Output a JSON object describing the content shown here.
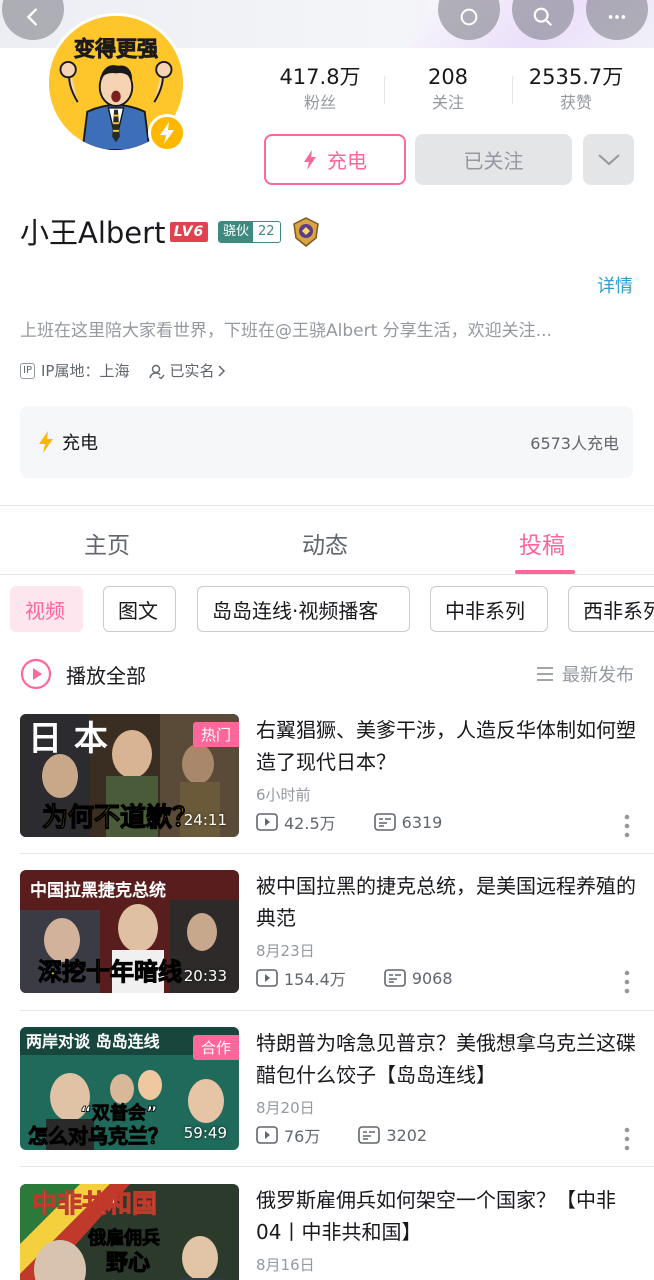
{
  "header": {
    "icons": [
      "back-icon",
      "share-icon",
      "search-icon",
      "more-icon"
    ]
  },
  "avatar_text": "变得更强",
  "stats": [
    {
      "value": "417.8万",
      "label": "粉丝"
    },
    {
      "value": "208",
      "label": "关注"
    },
    {
      "value": "2535.7万",
      "label": "获赞"
    }
  ],
  "actions": {
    "charge_label": "充电",
    "followed_label": "已关注"
  },
  "profile": {
    "name": "小王Albert",
    "level": "LV6",
    "medal_name": "骁伙",
    "medal_level": "22",
    "detail_link": "详情",
    "bio": "上班在这里陪大家看世界，下班在@王骁Albert 分享生活，欢迎关注...",
    "ip_tag": "IP",
    "ip_location": "IP属地：上海",
    "verified": "已实名"
  },
  "charge_card": {
    "label": "充电",
    "count": "6573人充电"
  },
  "tabs": [
    {
      "label": "主页",
      "active": false
    },
    {
      "label": "动态",
      "active": false
    },
    {
      "label": "投稿",
      "active": true
    }
  ],
  "chips": [
    {
      "label": "视频",
      "active": true
    },
    {
      "label": "图文",
      "active": false
    },
    {
      "label": "岛岛连线·视频播客",
      "active": false
    },
    {
      "label": "中非系列",
      "active": false
    },
    {
      "label": "西非系列",
      "active": false
    }
  ],
  "play_all": {
    "label": "播放全部",
    "sort": "最新发布"
  },
  "videos": [
    {
      "title": "右翼猖獗、美爹干涉，人造反华体制如何塑造了现代日本？",
      "date": "6小时前",
      "views": "42.5万",
      "comments": "6319",
      "duration": "24:11",
      "tag": "热门",
      "thumb_caption": "为何不道歉？",
      "thumb_heading": "日 本"
    },
    {
      "title": "被中国拉黑的捷克总统，是美国远程养殖的典范",
      "date": "8月23日",
      "views": "154.4万",
      "comments": "9068",
      "duration": "20:33",
      "tag": "",
      "thumb_caption": "深挖十年暗线",
      "thumb_heading": "中国拉黑捷克总统"
    },
    {
      "title": "特朗普为啥急见普京？美俄想拿乌克兰这碟醋包什么饺子【岛岛连线】",
      "date": "8月20日",
      "views": "76万",
      "comments": "3202",
      "duration": "59:49",
      "tag": "合作",
      "thumb_caption": "怎么对乌克兰？",
      "thumb_heading": "两岸对谈 岛岛连线",
      "thumb_sub": "“双普会”"
    },
    {
      "title": "俄罗斯雇佣兵如何架空一个国家？【中非04丨中非共和国】",
      "date": "8月16日",
      "views": "",
      "comments": "",
      "duration": "",
      "tag": "",
      "thumb_caption": "野心",
      "thumb_heading": "中非共和国",
      "thumb_sub": "俄雇佣兵"
    }
  ]
}
